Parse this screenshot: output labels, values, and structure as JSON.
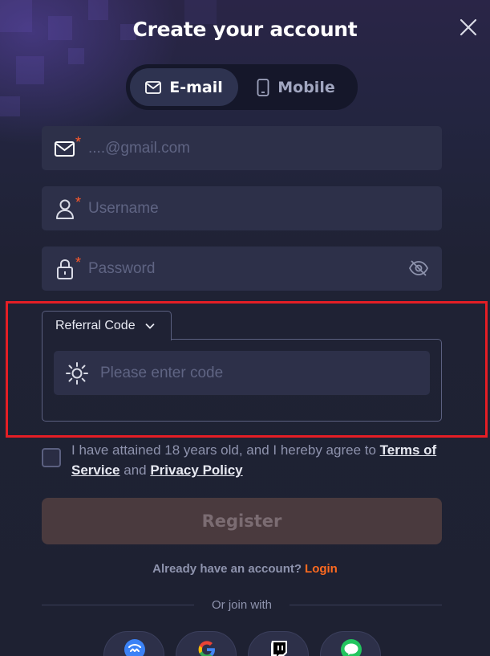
{
  "title": "Create your account",
  "tabs": [
    {
      "label": "E-mail",
      "icon": "mail-icon",
      "active": true
    },
    {
      "label": "Mobile",
      "icon": "phone-icon",
      "active": false
    }
  ],
  "fields": {
    "email": {
      "placeholder": "....@gmail.com",
      "value": "",
      "icon": "mail-icon",
      "required_mark": "*"
    },
    "username": {
      "placeholder": "Username",
      "value": "",
      "icon": "user-icon",
      "required_mark": "*"
    },
    "password": {
      "placeholder": "Password",
      "value": "",
      "icon": "lock-icon",
      "required_mark": "*",
      "toggle_icon": "eye-off-icon"
    }
  },
  "referral": {
    "label": "Referral Code",
    "placeholder": "Please enter code",
    "value": "",
    "icon": "sparkle-sun-icon"
  },
  "agreement": {
    "text_before": "I have attained 18 years old, and I hereby agree to",
    "terms": "Terms of Service",
    "and": "and",
    "privacy": "Privacy Policy",
    "checked": false
  },
  "register_label": "Register",
  "login_prompt": "Already have an account?",
  "login_link": "Login",
  "divider_text": "Or join with",
  "socials": [
    "walletconnect-icon",
    "google-icon",
    "twitch-icon",
    "line-icon"
  ],
  "colors": {
    "accent": "#ff6a1f",
    "required": "#ff5a2c",
    "highlight": "#e41e25",
    "register_bg": "#4a3a3e"
  }
}
